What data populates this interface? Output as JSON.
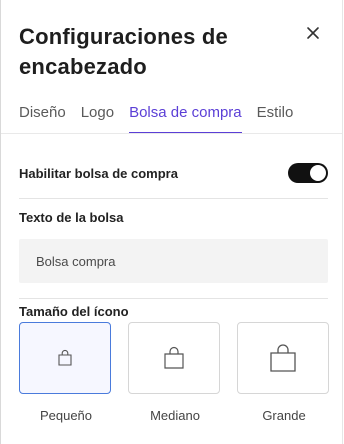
{
  "header": {
    "title": "Configuraciones de encabezado",
    "close_icon": "close-icon"
  },
  "tabs": [
    {
      "label": "Diseño",
      "active": false
    },
    {
      "label": "Logo",
      "active": false
    },
    {
      "label": "Bolsa de compra",
      "active": true
    },
    {
      "label": "Estilo",
      "active": false
    }
  ],
  "bag": {
    "enable_label": "Habilitar bolsa de compra",
    "enabled": true,
    "text_label": "Texto de la bolsa",
    "text_value": "Bolsa compra",
    "size_label": "Tamaño del ícono",
    "sizes": [
      {
        "label": "Pequeño",
        "selected": true,
        "icon": "shopping-bag-icon"
      },
      {
        "label": "Mediano",
        "selected": false,
        "icon": "shopping-bag-icon"
      },
      {
        "label": "Grande",
        "selected": false,
        "icon": "shopping-bag-icon"
      }
    ]
  },
  "colors": {
    "accent": "#5b3fd6",
    "selected_border": "#4a7bdc",
    "toggle_on": "#111111"
  }
}
